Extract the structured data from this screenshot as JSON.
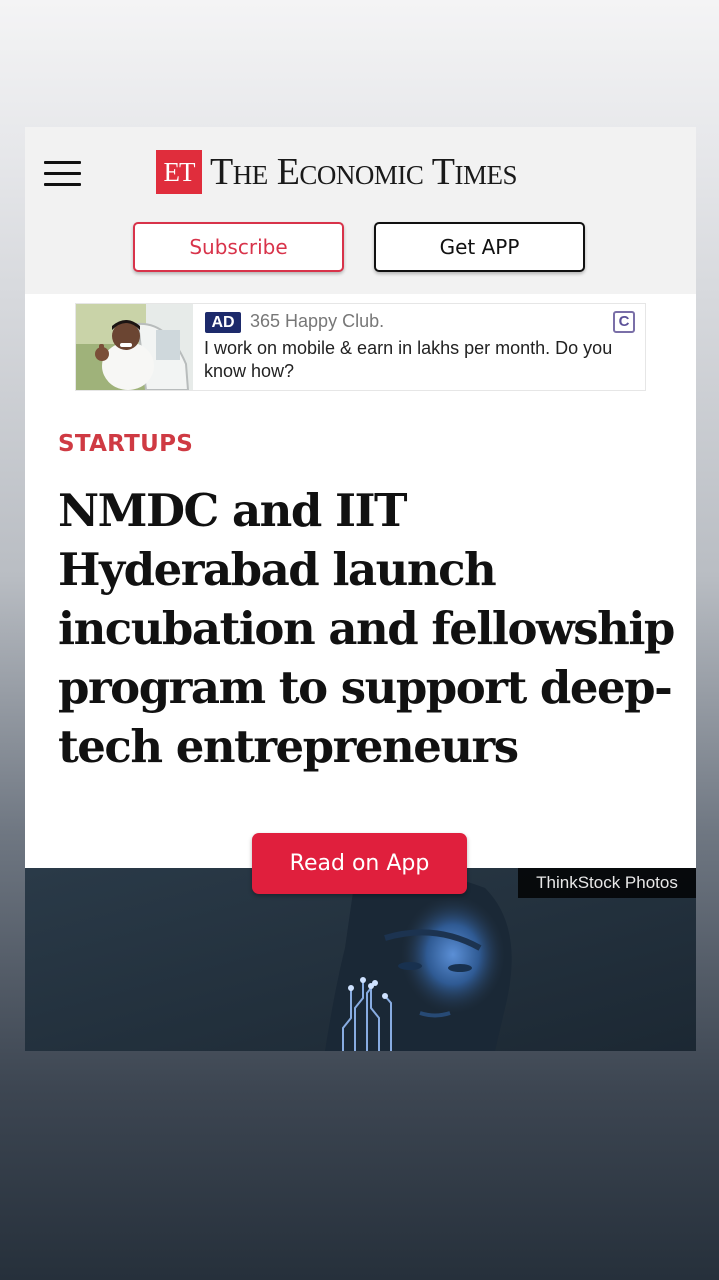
{
  "header": {
    "logo_mark": "ET",
    "logo_name": "The Economic Times",
    "subscribe_label": "Subscribe",
    "get_app_label": "Get APP",
    "menu_icon": "hamburger-menu-icon"
  },
  "ad": {
    "badge": "AD",
    "source": "365 Happy Club.",
    "text": "I work on mobile & earn in lakhs per month. Do you know how?",
    "choice_icon_letter": "C"
  },
  "article": {
    "section": "STARTUPS",
    "headline": "NMDC and IIT Hyderabad launch incubation and fellowship program to support deep-tech entrepreneurs",
    "image_credit": "ThinkStock Photos"
  },
  "cta": {
    "read_on_app": "Read on App"
  },
  "colors": {
    "brand_red": "#e02d3c",
    "section_red": "#cf3a43",
    "cta_red": "#e01f3d",
    "ad_badge": "#1d2a6b"
  }
}
